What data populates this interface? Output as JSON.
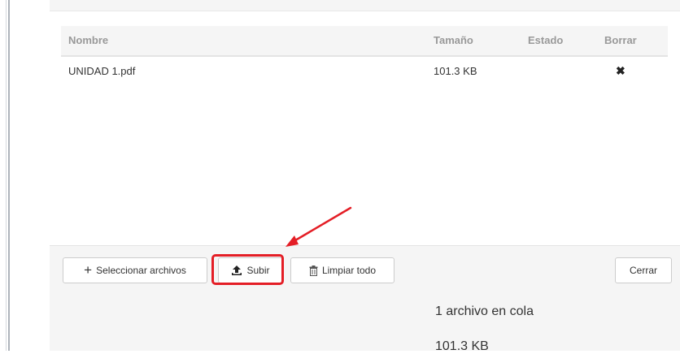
{
  "table": {
    "headers": {
      "name": "Nombre",
      "size": "Tamaño",
      "state": "Estado",
      "delete": "Borrar"
    },
    "rows": [
      {
        "name": "UNIDAD 1.pdf",
        "size": "101.3 KB",
        "state": "",
        "delete_icon": "close-icon"
      }
    ]
  },
  "footer": {
    "select_label": "Seleccionar archivos",
    "upload_label": "Subir",
    "clear_label": "Limpiar todo",
    "close_label": "Cerrar",
    "queue_text": "1 archivo en cola",
    "queue_size": "101.3 KB"
  },
  "annotation": {
    "color": "#e41e26"
  }
}
